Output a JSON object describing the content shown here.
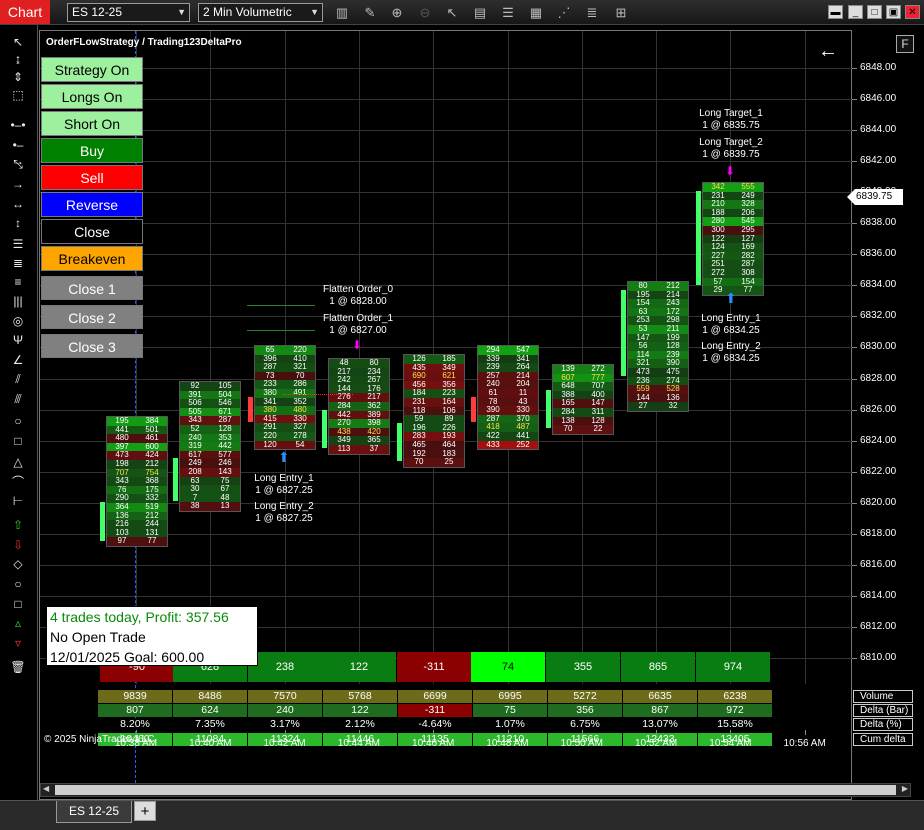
{
  "toolbar": {
    "chart_tab": "Chart",
    "instrument": "ES 12-25",
    "interval": "2 Min Volumetric"
  },
  "chart": {
    "strategy_title": "OrderFLowStrategy / Trading123DeltaPro",
    "f_button": "F",
    "current_price": "6839.75",
    "price_axis": [
      "6848.00",
      "6846.00",
      "6844.00",
      "6842.00",
      "6840.00",
      "6838.00",
      "6836.00",
      "6834.00",
      "6832.00",
      "6830.00",
      "6828.00",
      "6826.00",
      "6824.00",
      "6822.00",
      "6820.00",
      "6818.00",
      "6816.00",
      "6814.00",
      "6812.00",
      "6810.00"
    ],
    "time_axis": [
      "10:38 AM",
      "10:40 AM",
      "10:42 AM",
      "10:44 AM",
      "10:46 AM",
      "10:48 AM",
      "10:50 AM",
      "10:52 AM",
      "10:54 AM",
      "10:56 AM"
    ]
  },
  "strategy_buttons": [
    {
      "label": "Strategy On",
      "bg": "#9df09d",
      "fg": "#000"
    },
    {
      "label": "Longs On",
      "bg": "#9df09d",
      "fg": "#000"
    },
    {
      "label": "Short On",
      "bg": "#9df09d",
      "fg": "#000"
    },
    {
      "label": "Buy",
      "bg": "#008000",
      "fg": "#fff"
    },
    {
      "label": "Sell",
      "bg": "#ff0000",
      "fg": "#fff"
    },
    {
      "label": "Reverse",
      "bg": "#0000ff",
      "fg": "#fff"
    },
    {
      "label": "Close",
      "bg": "#000000",
      "fg": "#fff"
    },
    {
      "label": "Breakeven",
      "bg": "#ffa500",
      "fg": "#000"
    },
    {
      "label": "Close 1",
      "bg": "#808080",
      "fg": "#fff"
    },
    {
      "label": "Close 2",
      "bg": "#808080",
      "fg": "#fff"
    },
    {
      "label": "Close 3",
      "bg": "#808080",
      "fg": "#fff"
    }
  ],
  "bars": [
    {
      "rows": [
        [
          "195",
          "384"
        ],
        [
          "441",
          "501"
        ],
        [
          "480",
          "461"
        ],
        [
          "397",
          "600"
        ],
        [
          "473",
          "424"
        ],
        [
          "198",
          "212"
        ],
        [
          "707",
          "754"
        ],
        [
          "343",
          "368"
        ],
        [
          "76",
          "175"
        ],
        [
          "290",
          "332"
        ],
        [
          "364",
          "519"
        ],
        [
          "136",
          "212"
        ],
        [
          "216",
          "244"
        ],
        [
          "103",
          "131"
        ],
        [
          "97",
          "77"
        ]
      ]
    },
    {
      "rows": [
        [
          "92",
          "105"
        ],
        [
          "391",
          "504"
        ],
        [
          "506",
          "546"
        ],
        [
          "505",
          "671"
        ],
        [
          "343",
          "287"
        ],
        [
          "52",
          "128"
        ],
        [
          "240",
          "353"
        ],
        [
          "319",
          "442"
        ],
        [
          "617",
          "577"
        ],
        [
          "249",
          "246"
        ],
        [
          "208",
          "143"
        ],
        [
          "63",
          "75"
        ],
        [
          "30",
          "67"
        ],
        [
          "7",
          "48"
        ],
        [
          "38",
          "13"
        ]
      ]
    },
    {
      "rows": [
        [
          "65",
          "220"
        ],
        [
          "396",
          "410"
        ],
        [
          "287",
          "321"
        ],
        [
          "73",
          "70"
        ],
        [
          "233",
          "286"
        ],
        [
          "380",
          "491"
        ],
        [
          "341",
          "352"
        ],
        [
          "380",
          "480"
        ],
        [
          "415",
          "330"
        ],
        [
          "291",
          "327"
        ],
        [
          "220",
          "278"
        ],
        [
          "120",
          "54"
        ]
      ]
    },
    {
      "rows": [
        [
          "48",
          "80"
        ],
        [
          "217",
          "234"
        ],
        [
          "242",
          "267"
        ],
        [
          "144",
          "176"
        ],
        [
          "276",
          "217"
        ],
        [
          "284",
          "362"
        ],
        [
          "442",
          "389"
        ],
        [
          "270",
          "398"
        ],
        [
          "438",
          "420"
        ],
        [
          "349",
          "365"
        ],
        [
          "113",
          "37"
        ]
      ]
    },
    {
      "rows": [
        [
          "126",
          "185"
        ],
        [
          "435",
          "349"
        ],
        [
          "690",
          "621"
        ],
        [
          "456",
          "356"
        ],
        [
          "184",
          "223"
        ],
        [
          "231",
          "164"
        ],
        [
          "118",
          "106"
        ],
        [
          "59",
          "89"
        ],
        [
          "196",
          "226"
        ],
        [
          "283",
          "193"
        ],
        [
          "465",
          "464"
        ],
        [
          "192",
          "183"
        ],
        [
          "70",
          "25"
        ]
      ]
    },
    {
      "rows": [
        [
          "294",
          "547"
        ],
        [
          "339",
          "341"
        ],
        [
          "239",
          "264"
        ],
        [
          "257",
          "214"
        ],
        [
          "240",
          "204"
        ],
        [
          "61",
          "11"
        ],
        [
          "78",
          "43"
        ],
        [
          "390",
          "330"
        ],
        [
          "287",
          "370"
        ],
        [
          "418",
          "487"
        ],
        [
          "422",
          "441"
        ],
        [
          "433",
          "252"
        ]
      ]
    },
    {
      "rows": [
        [
          "139",
          "272"
        ],
        [
          "607",
          "777"
        ],
        [
          "648",
          "707"
        ],
        [
          "388",
          "400"
        ],
        [
          "165",
          "147"
        ],
        [
          "284",
          "311"
        ],
        [
          "138",
          "128"
        ],
        [
          "70",
          "22"
        ]
      ]
    },
    {
      "rows": [
        [
          "80",
          "212"
        ],
        [
          "195",
          "214"
        ],
        [
          "154",
          "243"
        ],
        [
          "63",
          "172"
        ],
        [
          "253",
          "298"
        ],
        [
          "53",
          "211"
        ],
        [
          "147",
          "199"
        ],
        [
          "56",
          "128"
        ],
        [
          "114",
          "239"
        ],
        [
          "321",
          "390"
        ],
        [
          "473",
          "475"
        ],
        [
          "236",
          "274"
        ],
        [
          "559",
          "528"
        ],
        [
          "144",
          "136"
        ],
        [
          "27",
          "32"
        ]
      ]
    },
    {
      "rows": [
        [
          "342",
          "555"
        ],
        [
          "231",
          "249"
        ],
        [
          "210",
          "328"
        ],
        [
          "188",
          "206"
        ],
        [
          "280",
          "545"
        ],
        [
          "300",
          "295"
        ],
        [
          "122",
          "127"
        ],
        [
          "124",
          "169"
        ],
        [
          "227",
          "282"
        ],
        [
          "251",
          "287"
        ],
        [
          "272",
          "308"
        ],
        [
          "57",
          "154"
        ],
        [
          "29",
          "77"
        ]
      ]
    }
  ],
  "annotations": {
    "flatten_0": "Flatten Order_0",
    "flatten_0_detail": "1 @ 6828.00",
    "flatten_1": "Flatten Order_1",
    "flatten_1_detail": "1 @ 6827.00",
    "entry1_a": "Long Entry_1",
    "entry1_a_detail": "1 @ 6827.25",
    "entry2_a": "Long Entry_2",
    "entry2_a_detail": "1 @ 6827.25",
    "target_1": "Long Target_1",
    "target_1_detail": "1 @ 6835.75",
    "target_2": "Long Target_2",
    "target_2_detail": "1 @ 6839.75",
    "entry1_b": "Long Entry_1",
    "entry1_b_detail": "1 @ 6834.25",
    "entry2_b": "Long Entry_2",
    "entry2_b_detail": "1 @ 6834.25"
  },
  "delta_boxes": [
    "-90",
    "628",
    "238",
    "122",
    "-311",
    "74",
    "355",
    "865",
    "974"
  ],
  "info": {
    "line1": "4 trades today, Profit: 357.56",
    "line2": "No Open Trade",
    "line3": "12/01/2025 Goal: 600.00"
  },
  "stats_table": {
    "labels": [
      "Volume",
      "Delta (Bar)",
      "Delta (%)",
      "Cum delta"
    ],
    "volume": [
      "9839",
      "8486",
      "7570",
      "5768",
      "6699",
      "6995",
      "5272",
      "6635",
      "6238"
    ],
    "delta_bar": [
      "807",
      "624",
      "240",
      "122",
      "-311",
      "75",
      "356",
      "867",
      "972"
    ],
    "delta_pct": [
      "8.20%",
      "7.35%",
      "3.17%",
      "2.12%",
      "-4.64%",
      "1.07%",
      "6.75%",
      "13.07%",
      "15.58%"
    ],
    "cum_delta": [
      "10460",
      "11084",
      "11324",
      "11446",
      "11135",
      "11210",
      "11566",
      "12433",
      "13405"
    ]
  },
  "copyright": "© 2025 NinjaTrader, LLC",
  "bottom_tab": "ES 12-25"
}
